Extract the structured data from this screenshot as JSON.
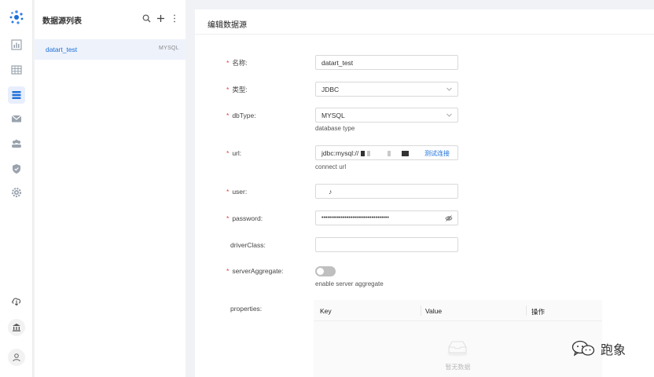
{
  "app": {
    "list_title": "数据源列表",
    "edit_title": "编辑数据源"
  },
  "nav": {
    "items": [
      "dashboard-icon",
      "table-icon",
      "list-icon",
      "mail-icon",
      "users-icon",
      "shield-icon",
      "gear-icon"
    ],
    "active": "list-icon",
    "bottom": [
      "cloud-download-icon",
      "bank-icon",
      "user-icon"
    ]
  },
  "list": {
    "items": [
      {
        "name": "datart_test",
        "type": "MYSQL"
      }
    ]
  },
  "form": {
    "name_label": "名称:",
    "name_value": "datart_test",
    "type_label": "类型:",
    "type_value": "JDBC",
    "dbtype_label": "dbType:",
    "dbtype_value": "MYSQL",
    "dbtype_hint": "database type",
    "url_label": "url:",
    "url_value": "jdbc:mysql://",
    "url_test": "测试连接",
    "url_hint": "connect url",
    "user_label": "user:",
    "user_value": "♪",
    "password_label": "password:",
    "password_value": "•••••••••••••••••••••••••••••••••••",
    "driver_label": "driverClass:",
    "driver_value": "",
    "agg_label": "serverAggregate:",
    "agg_hint": "enable server aggregate",
    "agg_enabled": false,
    "props_label": "properties:",
    "props_columns": [
      "Key",
      "Value",
      "操作"
    ],
    "props_empty": "暂无数据"
  },
  "watermark": {
    "text": "跑象"
  },
  "colors": {
    "accent": "#1b6fd8",
    "required": "#e23b3b",
    "active_bg": "#eef2fb"
  }
}
